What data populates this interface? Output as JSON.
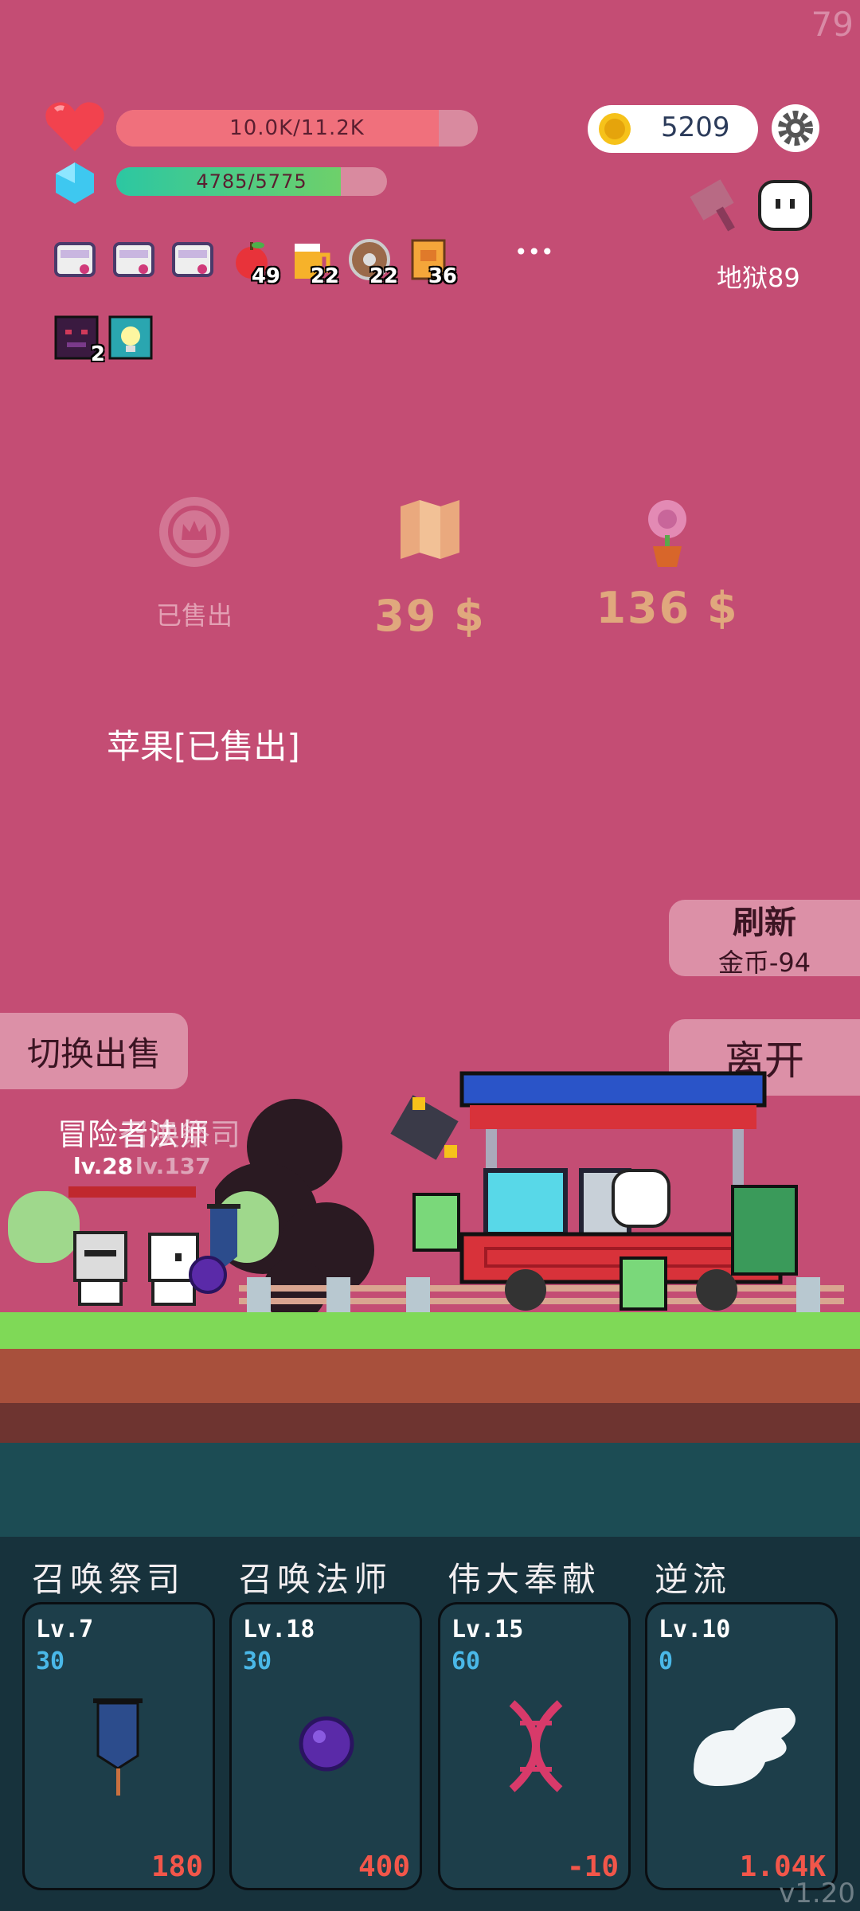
{
  "fps": "79",
  "player": {
    "hp_text": "10.0K/11.2K",
    "hp_fraction": 0.893,
    "mp_text": "4785/5775",
    "mp_fraction": 0.829
  },
  "gold": "5209",
  "level_label": "地狱89",
  "inventory": [
    {
      "icon": "scroll-ribbon-icon",
      "count": ""
    },
    {
      "icon": "scroll-ribbon-icon",
      "count": ""
    },
    {
      "icon": "scroll-ribbon-icon",
      "count": ""
    },
    {
      "icon": "apple-icon",
      "count": "49"
    },
    {
      "icon": "beer-icon",
      "count": "22"
    },
    {
      "icon": "shield-icon",
      "count": "22"
    },
    {
      "icon": "book-icon",
      "count": "36"
    }
  ],
  "more_label": "•••",
  "buffs": [
    {
      "icon": "demon-buff-icon",
      "count": "2"
    },
    {
      "icon": "light-buff-icon",
      "count": ""
    }
  ],
  "shop": {
    "items": [
      {
        "icon": "crown-coin-icon",
        "label": "已售出"
      },
      {
        "icon": "map-icon",
        "label": "39 $"
      },
      {
        "icon": "flower-pot-icon",
        "label": "136 $"
      }
    ],
    "status": "苹果[已售出]",
    "refresh_title": "刷新",
    "refresh_cost": "金币-94",
    "toggle_label": "切换出售",
    "leave_label": "离开"
  },
  "scene": {
    "unit_name": "冒险者法师",
    "unit_name2": "召唤祭司",
    "unit_level": "lv.28",
    "unit_level2": "lv.137"
  },
  "skills": [
    {
      "name": "召唤祭司",
      "lv": "Lv.7",
      "pts": "30",
      "cost": "180",
      "icon": "banner-icon"
    },
    {
      "name": "召唤法师",
      "lv": "Lv.18",
      "pts": "30",
      "cost": "400",
      "icon": "purple-orb-icon"
    },
    {
      "name": "伟大奉献",
      "lv": "Lv.15",
      "pts": "60",
      "cost": "-10",
      "icon": "dna-icon"
    },
    {
      "name": "逆流",
      "lv": "Lv.10",
      "pts": "0",
      "cost": "1.04K",
      "icon": "wing-icon"
    }
  ],
  "version": "v1.20",
  "colors": {
    "hp": "#f0707c",
    "mp": "#3ccc94",
    "bg": "#c44d74",
    "cost": "#f2564a"
  }
}
